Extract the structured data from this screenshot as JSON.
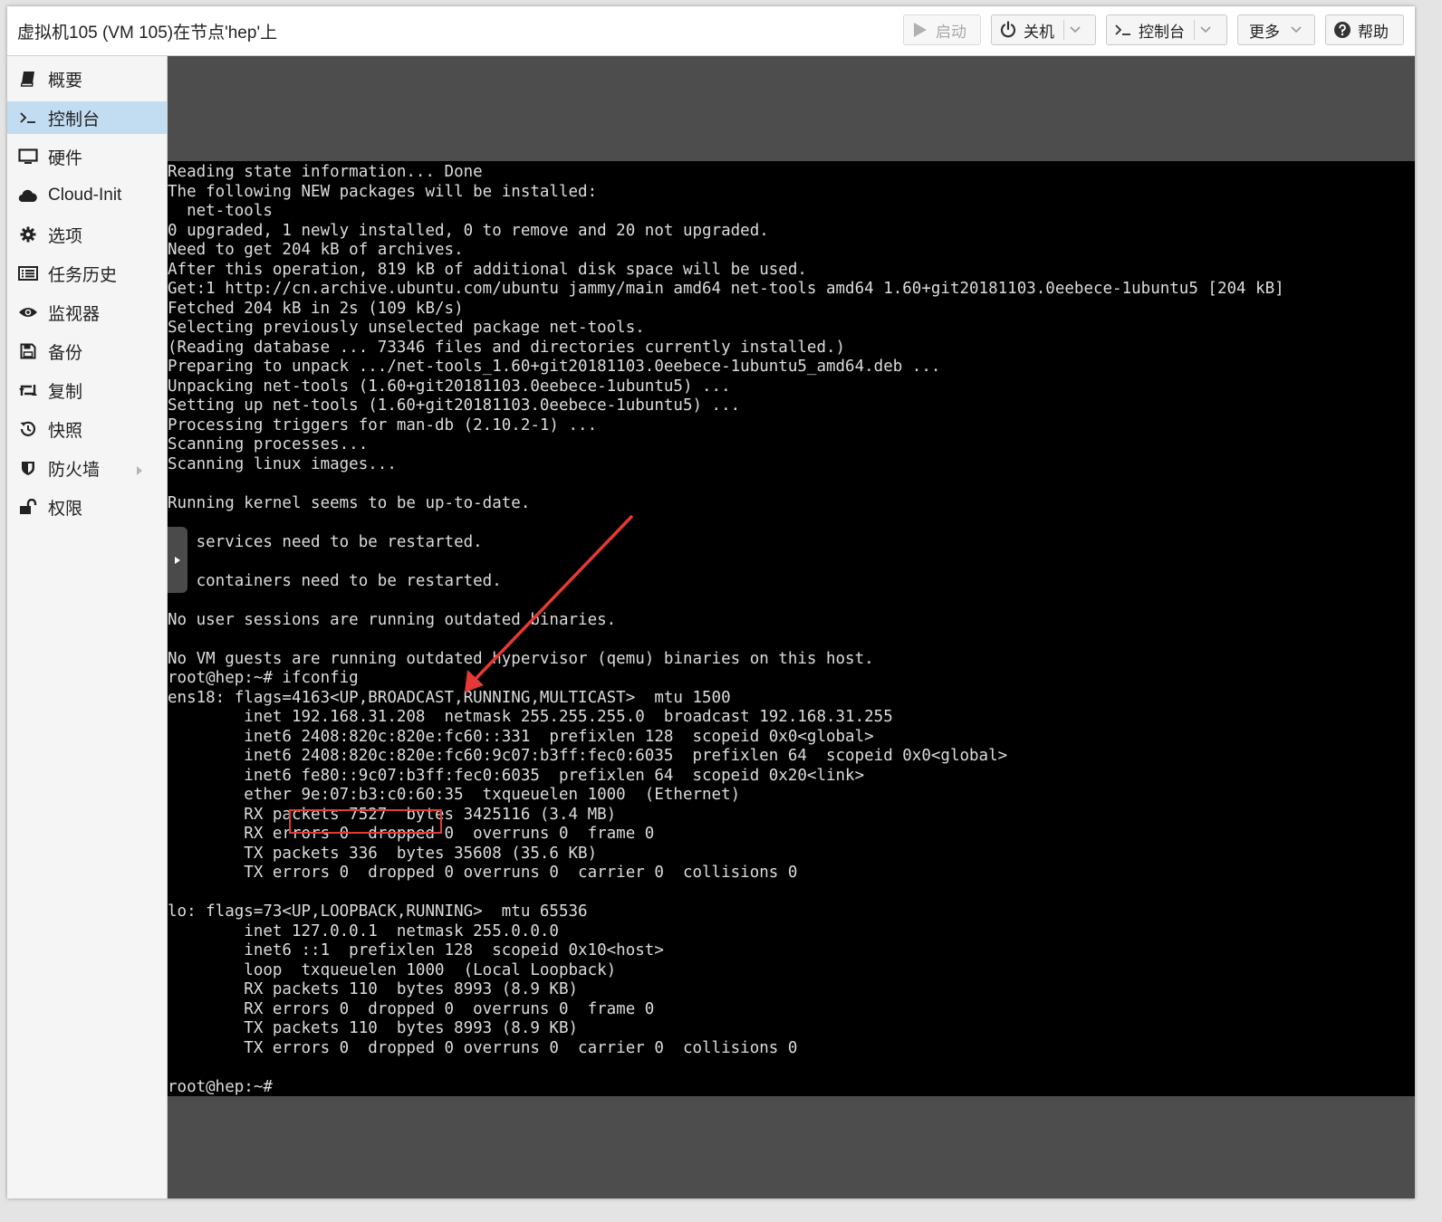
{
  "window": {
    "title": "虚拟机105 (VM 105)在节点'hep'上"
  },
  "toolbar": {
    "start_label": "启动",
    "shutdown_label": "关机",
    "console_label": "控制台",
    "more_label": "更多",
    "help_label": "帮助",
    "icons": {
      "start": "play-icon",
      "shutdown": "power-icon",
      "console": "terminal-icon",
      "help": "question-circle-icon",
      "dropdown": "chevron-down-icon"
    }
  },
  "sidebar": {
    "items": [
      {
        "label": "概要",
        "icon": "book-icon"
      },
      {
        "label": "控制台",
        "icon": "terminal-icon",
        "active": true
      },
      {
        "label": "硬件",
        "icon": "monitor-icon"
      },
      {
        "label": "Cloud-Init",
        "icon": "cloud-icon"
      },
      {
        "label": "选项",
        "icon": "gear-icon"
      },
      {
        "label": "任务历史",
        "icon": "list-icon"
      },
      {
        "label": "监视器",
        "icon": "eye-icon"
      },
      {
        "label": "备份",
        "icon": "floppy-icon"
      },
      {
        "label": "复制",
        "icon": "retweet-icon"
      },
      {
        "label": "快照",
        "icon": "history-icon"
      },
      {
        "label": "防火墙",
        "icon": "shield-icon",
        "expandable": true
      },
      {
        "label": "权限",
        "icon": "unlock-icon"
      }
    ]
  },
  "colors": {
    "accent_selected": "#c2ddf2",
    "terminal_bg": "#000000",
    "terminal_fg": "#dcdcdc",
    "annotation": "#e53935"
  },
  "console": {
    "highlighted_ip": "192.168.31.208",
    "lines": [
      "Reading state information... Done",
      "The following NEW packages will be installed:",
      "  net-tools",
      "0 upgraded, 1 newly installed, 0 to remove and 20 not upgraded.",
      "Need to get 204 kB of archives.",
      "After this operation, 819 kB of additional disk space will be used.",
      "Get:1 http://cn.archive.ubuntu.com/ubuntu jammy/main amd64 net-tools amd64 1.60+git20181103.0eebece-1ubuntu5 [204 kB]",
      "Fetched 204 kB in 2s (109 kB/s)",
      "Selecting previously unselected package net-tools.",
      "(Reading database ... 73346 files and directories currently installed.)",
      "Preparing to unpack .../net-tools_1.60+git20181103.0eebece-1ubuntu5_amd64.deb ...",
      "Unpacking net-tools (1.60+git20181103.0eebece-1ubuntu5) ...",
      "Setting up net-tools (1.60+git20181103.0eebece-1ubuntu5) ...",
      "Processing triggers for man-db (2.10.2-1) ...",
      "Scanning processes...",
      "Scanning linux images...",
      "",
      "Running kernel seems to be up-to-date.",
      "",
      "   services need to be restarted.",
      "",
      "   containers need to be restarted.",
      "",
      "No user sessions are running outdated binaries.",
      "",
      "No VM guests are running outdated hypervisor (qemu) binaries on this host.",
      "root@hep:~# ifconfig",
      "ens18: flags=4163<UP,BROADCAST,RUNNING,MULTICAST>  mtu 1500",
      "        inet 192.168.31.208  netmask 255.255.255.0  broadcast 192.168.31.255",
      "        inet6 2408:820c:820e:fc60::331  prefixlen 128  scopeid 0x0<global>",
      "        inet6 2408:820c:820e:fc60:9c07:b3ff:fec0:6035  prefixlen 64  scopeid 0x0<global>",
      "        inet6 fe80::9c07:b3ff:fec0:6035  prefixlen 64  scopeid 0x20<link>",
      "        ether 9e:07:b3:c0:60:35  txqueuelen 1000  (Ethernet)",
      "        RX packets 7527  bytes 3425116 (3.4 MB)",
      "        RX errors 0  dropped 0  overruns 0  frame 0",
      "        TX packets 336  bytes 35608 (35.6 KB)",
      "        TX errors 0  dropped 0 overruns 0  carrier 0  collisions 0",
      "",
      "lo: flags=73<UP,LOOPBACK,RUNNING>  mtu 65536",
      "        inet 127.0.0.1  netmask 255.0.0.0",
      "        inet6 ::1  prefixlen 128  scopeid 0x10<host>",
      "        loop  txqueuelen 1000  (Local Loopback)",
      "        RX packets 110  bytes 8993 (8.9 KB)",
      "        RX errors 0  dropped 0  overruns 0  frame 0",
      "        TX packets 110  bytes 8993 (8.9 KB)",
      "        TX errors 0  dropped 0 overruns 0  carrier 0  collisions 0",
      "",
      "root@hep:~#"
    ]
  }
}
